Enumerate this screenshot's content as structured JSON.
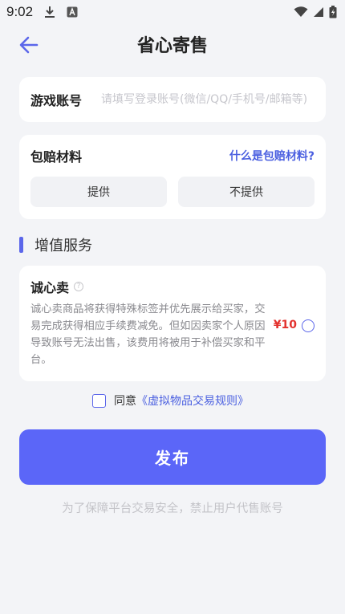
{
  "status_bar": {
    "time": "9:02"
  },
  "header": {
    "title": "省心寄售"
  },
  "account": {
    "label": "游戏账号",
    "placeholder": "请填写登录账号(微信/QQ/手机号/邮箱等)"
  },
  "compensation": {
    "label": "包赔材料",
    "help_link": "什么是包赔材料?",
    "options": [
      "提供",
      "不提供"
    ]
  },
  "value_added": {
    "section_title": "增值服务",
    "honest_sale": {
      "title": "诚心卖",
      "help_glyph": "?",
      "description": "诚心卖商品将获得特殊标签并优先展示给买家，交易完成获得相应手续费减免。但如因卖家个人原因导致账号无法出售，该费用将被用于补偿买家和平台。",
      "price": "¥10"
    }
  },
  "agreement": {
    "prefix": "同意",
    "link": "《虚拟物品交易规则》"
  },
  "publish_button": "发布",
  "footer_note": "为了保障平台交易安全，禁止用户代售账号",
  "colors": {
    "accent": "#5b66f8",
    "link": "#4a5fe0",
    "price": "#e3322e",
    "background": "#f3f4f7"
  }
}
